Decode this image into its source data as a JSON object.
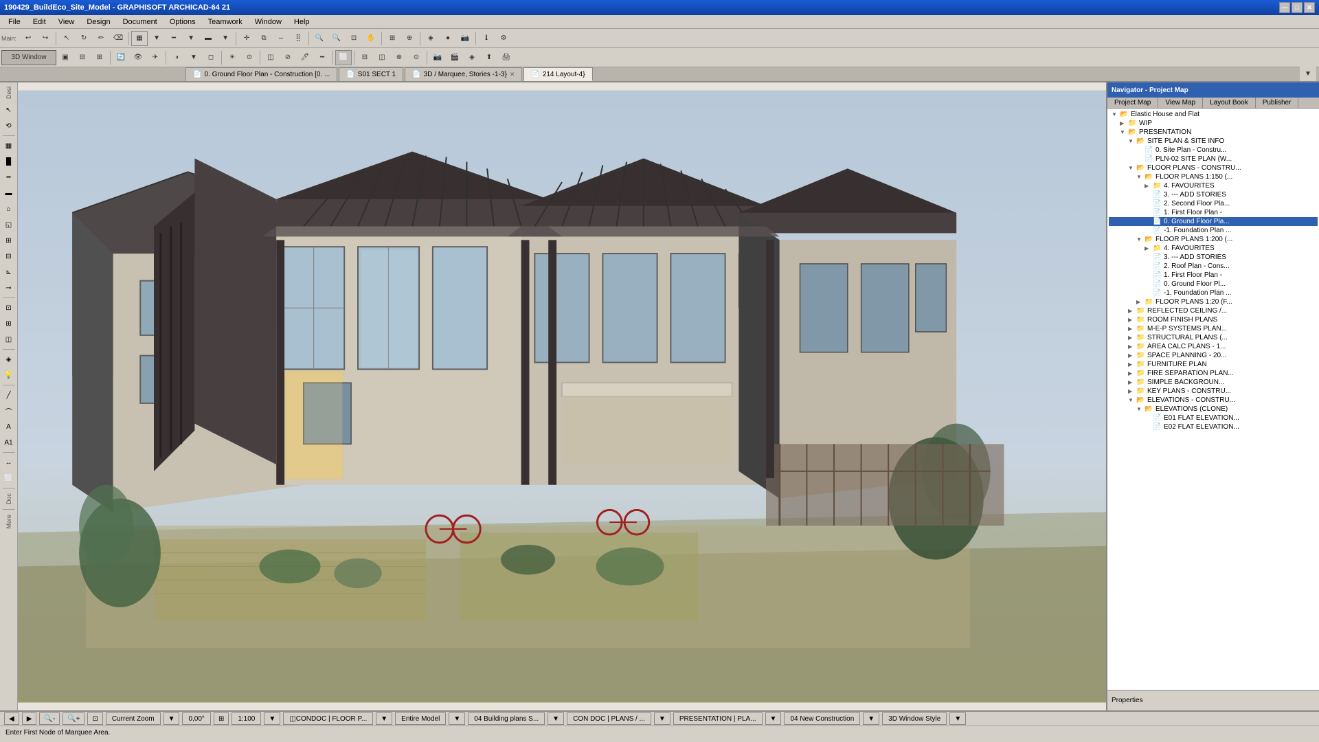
{
  "app": {
    "title": "190429_BuildEco_Site_Model - GRAPHISOFT ARCHICAD-64 21",
    "window_controls": [
      "—",
      "□",
      "✕"
    ]
  },
  "menu": {
    "items": [
      "File",
      "Edit",
      "View",
      "Design",
      "Document",
      "Options",
      "Teamwork",
      "Window",
      "Help"
    ]
  },
  "toolbar1": {
    "label": "Main:"
  },
  "toolbar2": {
    "mode_button": "3D Window"
  },
  "tabs": [
    {
      "label": "0. Ground Floor Plan - Construction [0. ...",
      "icon": "📄",
      "closable": false
    },
    {
      "label": "S01 SECT 1",
      "icon": "📄",
      "closable": false
    },
    {
      "label": "3D / Marquee, Stories -1-3}",
      "icon": "📄",
      "closable": true
    },
    {
      "label": "214 Layout-4}",
      "icon": "📄",
      "closable": false,
      "active": true
    }
  ],
  "right_panel": {
    "header": "Navigator - Project Map",
    "tabs": [
      "Project Map",
      "View Map",
      "Layout Book",
      "Publisher"
    ],
    "active_tab": "Project Map",
    "tree": [
      {
        "level": 0,
        "type": "folder",
        "label": "Elastic House and Flat",
        "expanded": true
      },
      {
        "level": 1,
        "type": "folder",
        "label": "WIP",
        "expanded": false
      },
      {
        "level": 1,
        "type": "folder",
        "label": "PRESENTATION",
        "expanded": true
      },
      {
        "level": 2,
        "type": "folder",
        "label": "SITE PLAN & SITE INFO",
        "expanded": true
      },
      {
        "level": 3,
        "type": "doc",
        "label": "0. Site Plan - Constru..."
      },
      {
        "level": 3,
        "type": "doc",
        "label": "PLN-02 SITE PLAN (W..."
      },
      {
        "level": 2,
        "type": "folder",
        "label": "FLOOR PLANS - CONSTRU...",
        "expanded": true
      },
      {
        "level": 3,
        "type": "folder",
        "label": "FLOOR PLANS 1:150 (...",
        "expanded": true
      },
      {
        "level": 4,
        "type": "folder",
        "label": "4. FAVOURITES",
        "expanded": false
      },
      {
        "level": 4,
        "type": "doc",
        "label": "3. --- ADD STORIES"
      },
      {
        "level": 4,
        "type": "doc",
        "label": "2. Second Floor Pla..."
      },
      {
        "level": 4,
        "type": "doc",
        "label": "1. First Floor Plan -"
      },
      {
        "level": 4,
        "type": "doc",
        "label": "0. Ground Floor Pla...",
        "active": true
      },
      {
        "level": 4,
        "type": "doc",
        "label": "-1. Foundation Plan ..."
      },
      {
        "level": 3,
        "type": "folder",
        "label": "FLOOR PLANS 1:200 (...",
        "expanded": true
      },
      {
        "level": 4,
        "type": "folder",
        "label": "4. FAVOURITES",
        "expanded": false
      },
      {
        "level": 4,
        "type": "doc",
        "label": "3. --- ADD STORIES"
      },
      {
        "level": 4,
        "type": "doc",
        "label": "2. Roof Plan - Cons..."
      },
      {
        "level": 4,
        "type": "doc",
        "label": "1. First Floor Plan -"
      },
      {
        "level": 4,
        "type": "doc",
        "label": "0. Ground Floor Pl..."
      },
      {
        "level": 4,
        "type": "doc",
        "label": "-1. Foundation Plan ..."
      },
      {
        "level": 3,
        "type": "folder",
        "label": "FLOOR PLANS 1:20 (F...",
        "expanded": false
      },
      {
        "level": 2,
        "type": "folder",
        "label": "REFLECTED CEILING /...",
        "expanded": false
      },
      {
        "level": 2,
        "type": "folder",
        "label": "ROOM FINISH PLANS",
        "expanded": false
      },
      {
        "level": 2,
        "type": "folder",
        "label": "M-E-P SYSTEMS PLAN...",
        "expanded": false
      },
      {
        "level": 2,
        "type": "folder",
        "label": "STRUCTURAL PLANS (...",
        "expanded": false
      },
      {
        "level": 2,
        "type": "folder",
        "label": "AREA CALC PLANS - 1...",
        "expanded": false
      },
      {
        "level": 2,
        "type": "folder",
        "label": "SPACE PLANNING - 20...",
        "expanded": false
      },
      {
        "level": 2,
        "type": "folder",
        "label": "FURNITURE PLAN",
        "expanded": false
      },
      {
        "level": 2,
        "type": "folder",
        "label": "FIRE SEPARATION PLAN...",
        "expanded": false
      },
      {
        "level": 2,
        "type": "folder",
        "label": "SIMPLE BACKGROUN...",
        "expanded": false
      },
      {
        "level": 2,
        "type": "folder",
        "label": "KEY PLANS - CONSTRU...",
        "expanded": false
      },
      {
        "level": 2,
        "type": "folder",
        "label": "ELEVATIONS - CONSTRU...",
        "expanded": true
      },
      {
        "level": 3,
        "type": "folder",
        "label": "ELEVATIONS (CLONE)",
        "expanded": true
      },
      {
        "level": 4,
        "type": "doc",
        "label": "E01 FLAT ELEVATION..."
      },
      {
        "level": 4,
        "type": "doc",
        "label": "E02 FLAT ELEVATION..."
      }
    ]
  },
  "viewport": {
    "label": ""
  },
  "status_bar": {
    "zoom_label": "Current Zoom",
    "zoom_value": "0,00°",
    "scale": "1:100",
    "layer": "CONDOC | FLOOR P...",
    "stories": "Entire Model",
    "building_plans": "04 Building plans S...",
    "con_doc": "CON DOC | PLANS / ...",
    "presentation": "PRESENTATION | PLA...",
    "new_construction": "04 New Construction",
    "style": "3D Window Style"
  },
  "message_bar": {
    "text": "Enter First Node of Marquee Area."
  },
  "left_panel": {
    "labels": [
      "Desi",
      "Doc",
      "More"
    ]
  },
  "properties_tab": {
    "label": "Properties"
  }
}
